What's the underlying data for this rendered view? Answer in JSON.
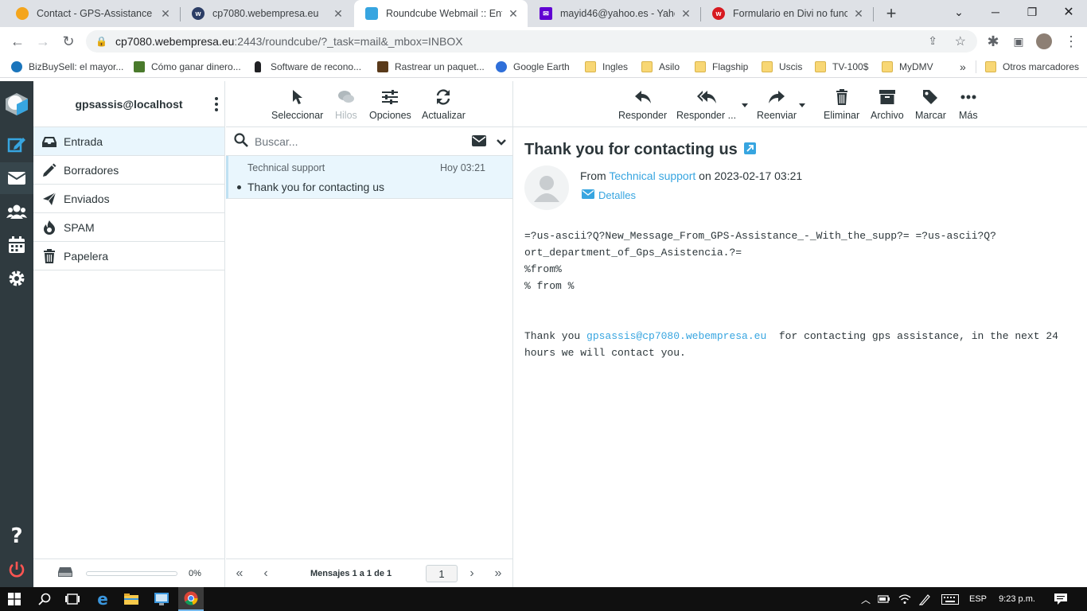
{
  "browser": {
    "tabs": [
      {
        "label": "Contact - GPS-Assistance",
        "fav_color": "#f4a51c"
      },
      {
        "label": "cp7080.webempresa.eu",
        "fav_color": "#2c3e66"
      },
      {
        "label": "Roundcube Webmail :: Entrad",
        "fav_color": "#37a5e0"
      },
      {
        "label": "mayid46@yahoo.es - Yahoo M",
        "fav_color": "#6001d2"
      },
      {
        "label": "Formulario en Divi no funcion",
        "fav_color": "#d71920"
      }
    ],
    "new_tab": "+",
    "url_host": "cp7080.webempresa.eu",
    "url_path": ":2443/roundcube/?_task=mail&_mbox=INBOX",
    "bookmarks": [
      "BizBuySell: el mayor...",
      "Cómo ganar dinero...",
      "Software de recono...",
      "Rastrear un paquet...",
      "Google Earth",
      "Ingles",
      "Asilo",
      "Flagship",
      "Uscis",
      "TV-100$",
      "MyDMV"
    ],
    "bookmarks_more": "»",
    "other_bookmarks": "Otros marcadores"
  },
  "folders": {
    "account": "gpsassis@localhost",
    "items": [
      "Entrada",
      "Borradores",
      "Enviados",
      "SPAM",
      "Papelera"
    ],
    "quota": "0%",
    "quota_fraction": 0
  },
  "list_toolbar": {
    "select": "Seleccionar",
    "threads": "Hilos",
    "options": "Opciones",
    "refresh": "Actualizar"
  },
  "search": {
    "placeholder": "Buscar..."
  },
  "messages": [
    {
      "from": "Technical support",
      "date": "Hoy 03:21",
      "subject": "Thank you for contacting us"
    }
  ],
  "pager": {
    "text": "Mensajes 1 a 1 de 1",
    "page": "1"
  },
  "preview_toolbar": {
    "reply": "Responder",
    "reply_all": "Responder ...",
    "forward": "Reenviar",
    "delete": "Eliminar",
    "archive": "Archivo",
    "mark": "Marcar",
    "more": "Más"
  },
  "message": {
    "subject": "Thank you for contacting us",
    "from_prefix": "From",
    "from_name": "Technical support",
    "on": "on",
    "date": "2023-02-17 03:21",
    "details": "Detalles",
    "body_line1": "=?us-ascii?Q?New_Message_From_GPS-Assistance_-_With_the_supp?= =?us-ascii?Q?",
    "body_line2": "ort_department_of_Gps_Asistencia.?=",
    "body_line3": "%from%",
    "body_line4": "% from %",
    "body_thanks": "Thank you ",
    "body_email": "gpsassis@cp7080.webempresa.eu",
    "body_rest": "  for contacting gps assistance, in the next 24 hours we will contact you."
  },
  "taskbar": {
    "lang": "ESP",
    "time": "9:23 p.m."
  },
  "colors": {
    "accent": "#37a5e0",
    "nav_bg": "#2f3a3f",
    "selected_bg": "#e9f6fd",
    "logout": "#ff5552"
  }
}
